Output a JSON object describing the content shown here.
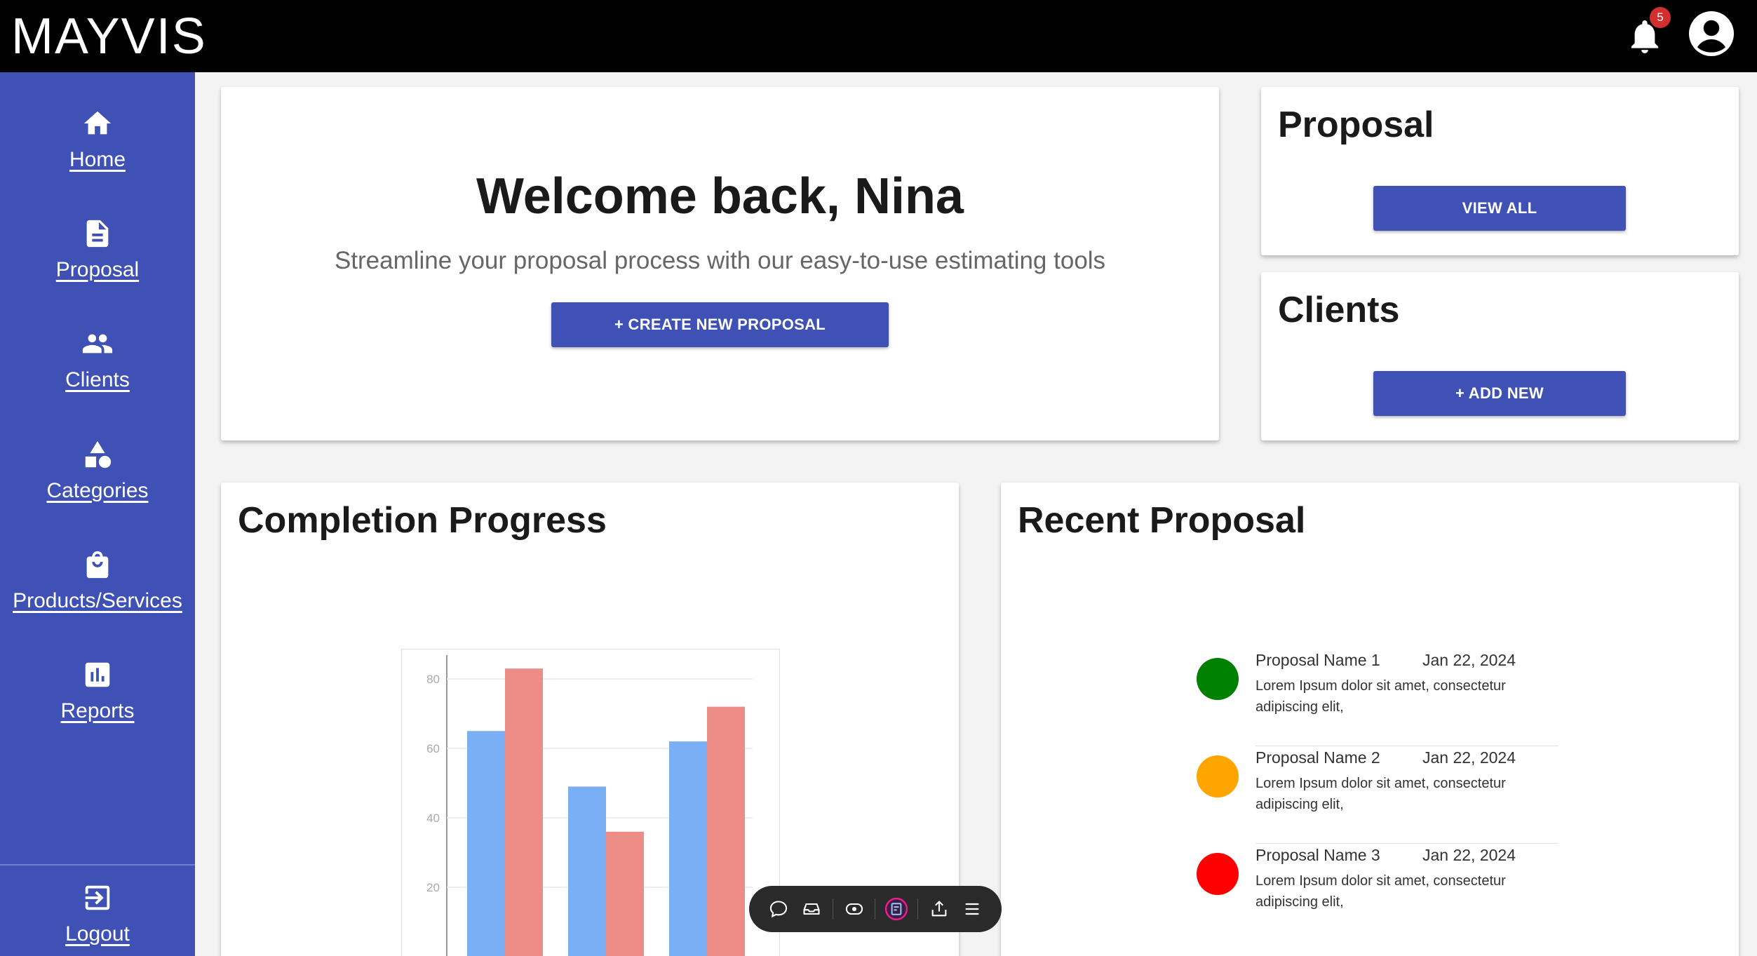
{
  "app": {
    "brand": "MAYVIS",
    "notification_count": "5"
  },
  "sidebar": {
    "items": [
      {
        "label": "Home",
        "icon": "home-icon"
      },
      {
        "label": "Proposal",
        "icon": "document-icon"
      },
      {
        "label": "Clients",
        "icon": "people-icon"
      },
      {
        "label": "Categories",
        "icon": "shapes-icon"
      },
      {
        "label": "Products/Services",
        "icon": "shopping-bag-icon"
      },
      {
        "label": "Reports",
        "icon": "bar-chart-icon"
      }
    ],
    "logout": {
      "label": "Logout",
      "icon": "logout-icon"
    }
  },
  "welcome": {
    "title": "Welcome back, Nina",
    "subtitle": "Streamline your proposal process with our easy-to-use estimating tools",
    "create_button": "+ CREATE NEW PROPOSAL"
  },
  "proposal_card": {
    "title": "Proposal",
    "button": "VIEW ALL"
  },
  "clients_card": {
    "title": "Clients",
    "button": "+ ADD NEW"
  },
  "progress_card": {
    "title": "Completion Progress"
  },
  "recent_card": {
    "title": "Recent Proposal",
    "items": [
      {
        "name": "Proposal Name 1",
        "date": "Jan 22, 2024",
        "desc": "Lorem Ipsum dolor sit amet, consectetur adipiscing elit,",
        "status_color": "#008000"
      },
      {
        "name": "Proposal Name 2",
        "date": "Jan 22, 2024",
        "desc": "Lorem Ipsum dolor sit amet, consectetur adipiscing elit,",
        "status_color": "#FFA500"
      },
      {
        "name": "Proposal Name 3",
        "date": "Jan 22, 2024",
        "desc": "Lorem Ipsum dolor sit amet, consectetur adipiscing elit,",
        "status_color": "#FF0000"
      }
    ]
  },
  "chart_data": {
    "type": "bar",
    "categories": [
      "",
      "",
      ""
    ],
    "series": [
      {
        "values": [
          65,
          49,
          62
        ],
        "color": "#7AAFF5"
      },
      {
        "values": [
          83,
          36,
          72
        ],
        "color": "#EC8E87"
      }
    ],
    "ticks": [
      "80",
      "60",
      "40",
      "20"
    ],
    "title": "",
    "xlabel": "",
    "ylabel": "",
    "ylim": [
      0,
      100
    ],
    "grid": true
  },
  "toolbar": {
    "icons": [
      "comment-icon",
      "inbox-icon",
      "eye-icon",
      "record-icon",
      "share-icon",
      "menu-icon"
    ]
  },
  "colors": {
    "primary": "#3f51b5",
    "topbar": "#000000",
    "badge": "#d32f2f"
  }
}
